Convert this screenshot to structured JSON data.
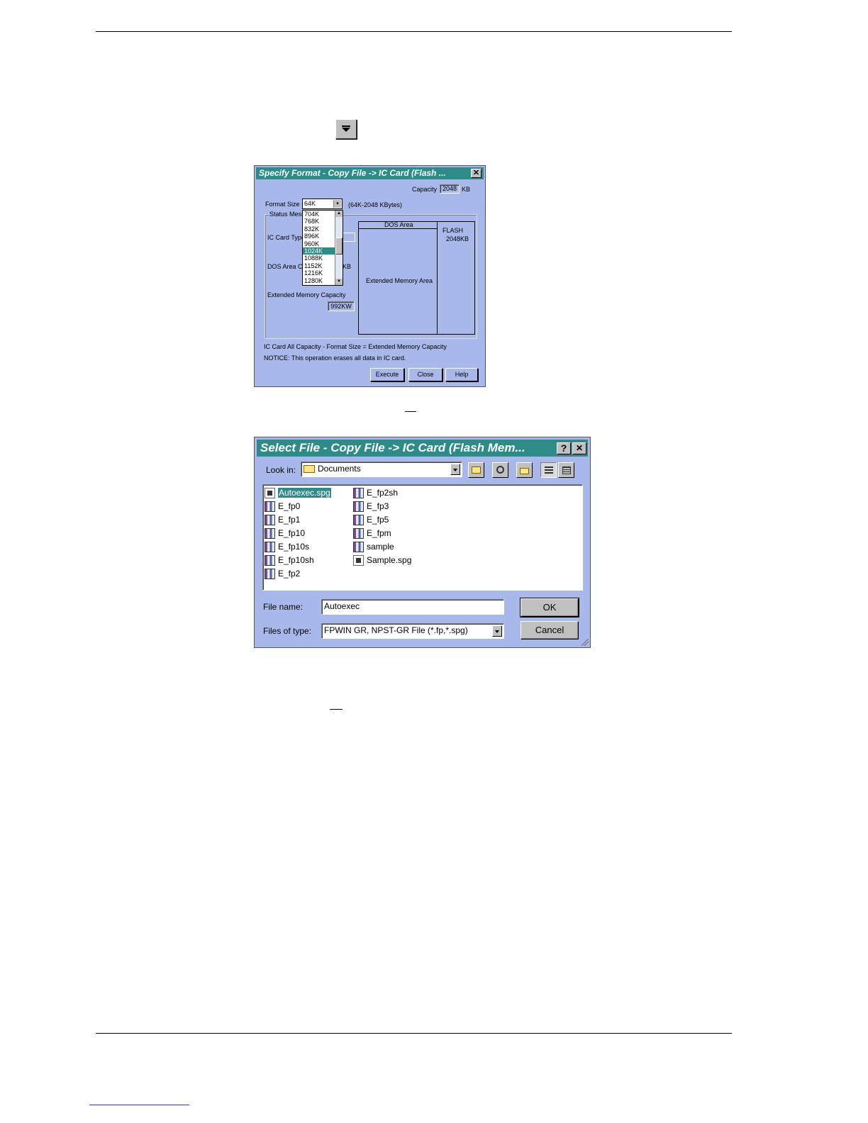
{
  "dialog1": {
    "title": "Specify Format - Copy File -> IC Card (Flash ...",
    "close_glyph": "✕",
    "capacity_label": "Capacity",
    "capacity_value": "2048",
    "capacity_unit": "KB",
    "format_size_label": "Format Size",
    "format_size_value": "64K",
    "format_size_range": "(64K-2048 KBytes)",
    "status_message_label": "Status Mess",
    "ic_card_type_label": "IC Card Type",
    "dos_area_label": "DOS Area C",
    "dos_area_unit": "KB",
    "extended_memory_label": "Extended Memory Capacity",
    "extended_memory_value": "992KW",
    "dos_area_header": "DOS Area",
    "extended_memory_area": "Extended Memory Area",
    "flash_label": "FLASH",
    "flash_value": "2048KB",
    "formula_text": "IC Card All Capacity - Format Size = Extended Memory Capacity",
    "notice_text": "NOTICE: This operation erases all data in IC card.",
    "options": [
      "704K",
      "768K",
      "832K",
      "896K",
      "960K",
      "1024K",
      "1088K",
      "1152K",
      "1216K",
      "1280K"
    ],
    "selected_option": "1024K",
    "buttons": {
      "execute": "Execute",
      "close": "Close",
      "help": "Help"
    }
  },
  "dialog2": {
    "title": "Select File - Copy File -> IC Card (Flash Mem...",
    "help_glyph": "?",
    "close_glyph": "✕",
    "look_in_label": "Look in:",
    "look_in_value": "Documents",
    "files_col1": [
      "Autoexec.spg",
      "E_fp0",
      "E_fp1",
      "E_fp10",
      "E_fp10s",
      "E_fp10sh",
      "E_fp2"
    ],
    "files_col2": [
      "E_fp2sh",
      "E_fp3",
      "E_fp5",
      "E_fpm",
      "sample",
      "Sample.spg"
    ],
    "selected_file": "Autoexec.spg",
    "file_name_label": "File name:",
    "file_name_value": "Autoexec",
    "files_of_type_label": "Files of type:",
    "files_of_type_value": "FPWIN GR, NPST-GR File (*.fp,*.spg)",
    "ok_label": "OK",
    "cancel_label": "Cancel"
  }
}
